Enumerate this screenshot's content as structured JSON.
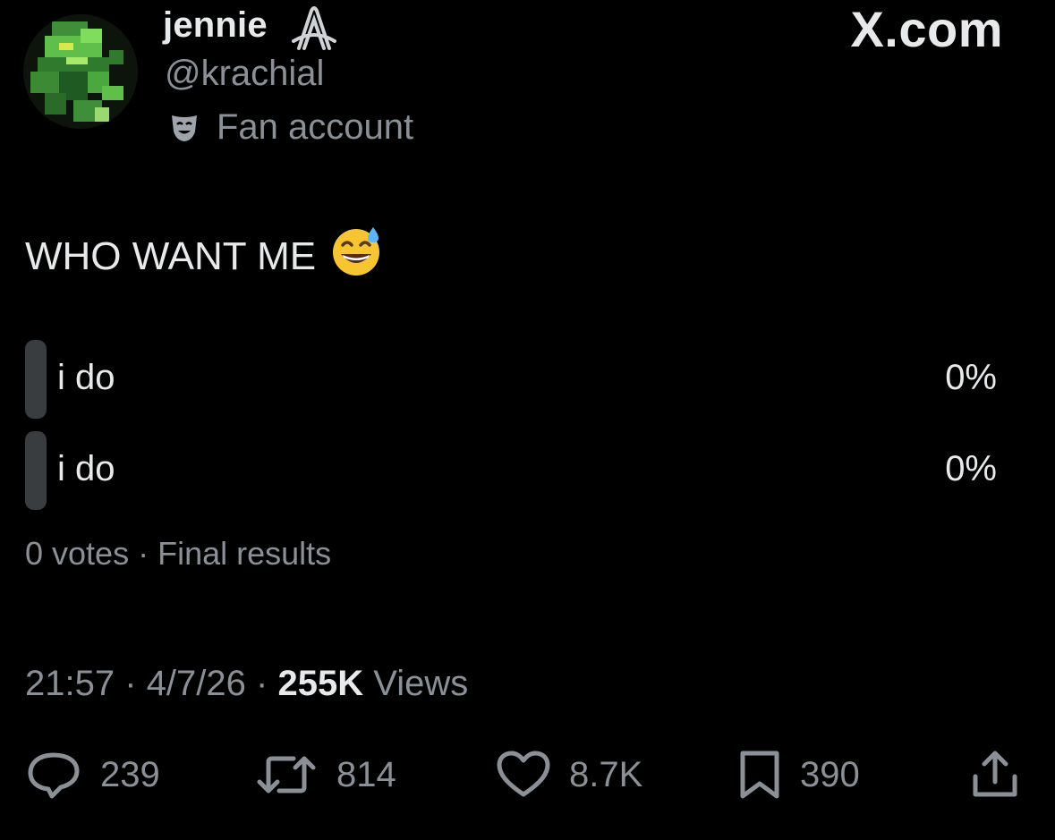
{
  "author": {
    "display_name": "jennie",
    "handle": "@krachial",
    "label": "Fan account",
    "avatar_icon": "pixel-art-green-creature-avatar",
    "affiliation_icon": "paperclip-badge-icon",
    "label_icon": "theater-mask-icon"
  },
  "brand": "X.com",
  "tweet": {
    "text": "WHO WANT ME",
    "emoji": "😅"
  },
  "poll": {
    "options": [
      {
        "label": "i do",
        "percent": "0%"
      },
      {
        "label": "i do",
        "percent": "0%"
      }
    ],
    "votes": "0 votes",
    "sep": "·",
    "status": "Final results"
  },
  "meta": {
    "time": "21:57",
    "sep": "·",
    "date": "4/7/26",
    "views_count": "255K",
    "views_label": "Views"
  },
  "actions": {
    "replies": "239",
    "reposts": "814",
    "likes": "8.7K",
    "bookmarks": "390"
  },
  "colors": {
    "background": "#000000",
    "primary_text": "#e7e9ea",
    "secondary_text": "#8b9096",
    "poll_bar": "#3a3d40"
  }
}
